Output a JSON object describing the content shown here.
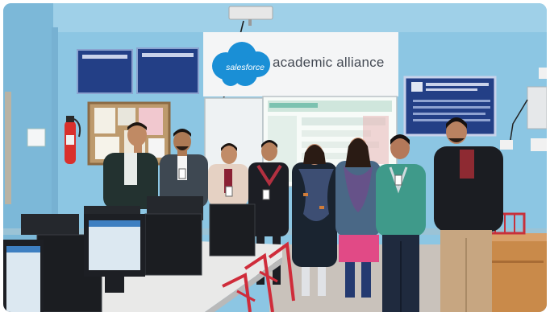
{
  "banner": {
    "brand": "salesforce",
    "program": "academic alliance"
  },
  "colors": {
    "wall": "#8cc6e3",
    "banner_bg": "#f4f5f6",
    "salesforce_blue": "#1a8fd6",
    "board_navy": "#233f86"
  },
  "icons": {
    "logo": "salesforce-cloud-logo",
    "extinguisher": "fire-extinguisher-icon"
  }
}
